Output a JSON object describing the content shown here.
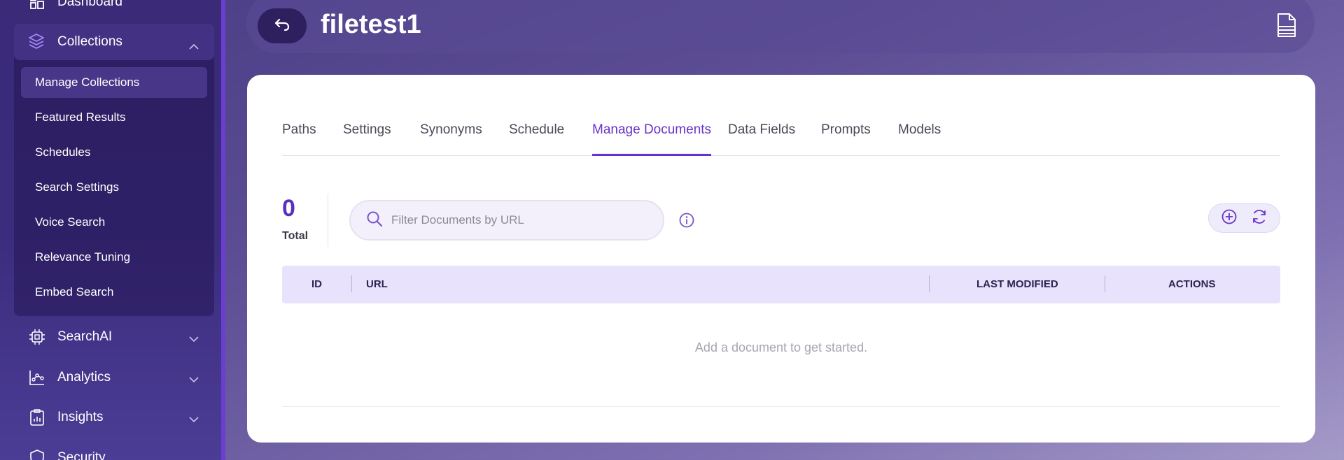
{
  "sidebar": {
    "dashboard_label": "Dashboard",
    "collections_label": "Collections",
    "sub_items": [
      {
        "label": "Manage Collections",
        "active": true
      },
      {
        "label": "Featured Results"
      },
      {
        "label": "Schedules"
      },
      {
        "label": "Search Settings"
      },
      {
        "label": "Voice Search"
      },
      {
        "label": "Relevance Tuning"
      },
      {
        "label": "Embed Search"
      }
    ],
    "groups": [
      {
        "label": "SearchAI",
        "icon": "chip-icon"
      },
      {
        "label": "Analytics",
        "icon": "analytics-icon"
      },
      {
        "label": "Insights",
        "icon": "clipboard-icon"
      },
      {
        "label": "Security",
        "icon": "shield-icon"
      }
    ]
  },
  "header": {
    "title": "filetest1"
  },
  "tabs": [
    "Paths",
    "Settings",
    "Synonyms",
    "Schedule",
    "Manage Documents",
    "Data Fields",
    "Prompts",
    "Models"
  ],
  "active_tab": "Manage Documents",
  "documents": {
    "total_count": "0",
    "total_label": "Total",
    "search_placeholder": "Filter Documents by URL",
    "columns": {
      "id": "ID",
      "url": "URL",
      "last_modified": "LAST MODIFIED",
      "actions": "ACTIONS"
    },
    "empty_message": "Add a document to get started."
  },
  "colors": {
    "accent": "#6a32c9",
    "sidebar_bg": "#3a2a78",
    "table_header_bg": "#e8e2fc"
  }
}
